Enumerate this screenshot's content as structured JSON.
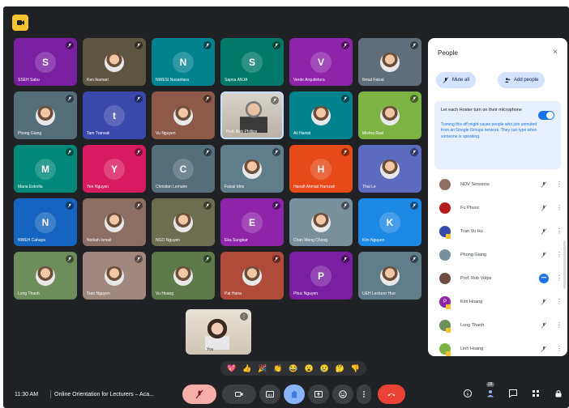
{
  "meeting": {
    "time": "11:30 AM",
    "title": "Online Orientation for Lecturers – Aca..."
  },
  "colors": {
    "background": "#202124",
    "control": "#3c4043",
    "end_call": "#ea4335",
    "accent": "#8ab4f8",
    "host_box": "#e8f0fe"
  },
  "tiles": [
    {
      "name": "SSEH Sabu",
      "letter": "S",
      "bg": "#7b1fa2",
      "type": "letter"
    },
    {
      "name": "Ken Ikamari",
      "letter": "",
      "bg": "#5d5540",
      "type": "photo"
    },
    {
      "name": "NWESI Nusantara",
      "letter": "N",
      "bg": "#00838f",
      "type": "letter"
    },
    {
      "name": "Sapna ANJA",
      "letter": "S",
      "bg": "#00796b",
      "type": "letter"
    },
    {
      "name": "Verde Arquitetura",
      "letter": "V",
      "bg": "#8e24aa",
      "type": "letter"
    },
    {
      "name": "Ikmal Faizal",
      "letter": "",
      "bg": "#5f6e78",
      "type": "photo"
    },
    {
      "name": "Phong Giang",
      "letter": "",
      "bg": "#546e7a",
      "type": "photo"
    },
    {
      "name": "Tam Tranvali",
      "letter": "t",
      "bg": "#3949ab",
      "type": "letter"
    },
    {
      "name": "Vu Nguyen",
      "letter": "",
      "bg": "#8d5a4a",
      "type": "photo"
    },
    {
      "name": "Prof. Rob Phillips",
      "letter": "",
      "bg": "#cfc8bb",
      "type": "video"
    },
    {
      "name": "Ali Hamid",
      "letter": "",
      "bg": "#00838f",
      "type": "photo"
    },
    {
      "name": "Mishra Ravi",
      "letter": "",
      "bg": "#7cb342",
      "type": "photo"
    },
    {
      "name": "Maria Estrella",
      "letter": "M",
      "bg": "#00897b",
      "type": "letter"
    },
    {
      "name": "Yen Nguyen",
      "letter": "Y",
      "bg": "#d81b60",
      "type": "letter"
    },
    {
      "name": "Christian Lemaire",
      "letter": "C",
      "bg": "#546e7a",
      "type": "letter"
    },
    {
      "name": "Faisal Idris",
      "letter": "",
      "bg": "#607d8b",
      "type": "photo"
    },
    {
      "name": "Hanafi Ahmad Hamzah",
      "letter": "H",
      "bg": "#e64a19",
      "type": "letter"
    },
    {
      "name": "Thai Le",
      "letter": "",
      "bg": "#5c6bc0",
      "type": "photo"
    },
    {
      "name": "NWEH Cahaya",
      "letter": "N",
      "bg": "#1565c0",
      "type": "letter"
    },
    {
      "name": "Norliah Ismail",
      "letter": "",
      "bg": "#8d6e63",
      "type": "photo"
    },
    {
      "name": "NGO Nguyen",
      "letter": "",
      "bg": "#6d6d4f",
      "type": "photo"
    },
    {
      "name": "Eka Sungkar",
      "letter": "E",
      "bg": "#8e24aa",
      "type": "letter"
    },
    {
      "name": "Chan Meng Chong",
      "letter": "",
      "bg": "#78909c",
      "type": "photo"
    },
    {
      "name": "Kim Nguyen",
      "letter": "K",
      "bg": "#1e88e5",
      "type": "letter"
    },
    {
      "name": "Long Thanh",
      "letter": "",
      "bg": "#6b8e5a",
      "type": "photo"
    },
    {
      "name": "Tran Nguyen",
      "letter": "",
      "bg": "#a1887f",
      "type": "photo"
    },
    {
      "name": "Vu Hoang",
      "letter": "",
      "bg": "#5d7a4a",
      "type": "photo"
    },
    {
      "name": "Pat Hana",
      "letter": "",
      "bg": "#b04a3a",
      "type": "photo"
    },
    {
      "name": "Phuc Nguyen",
      "letter": "P",
      "bg": "#7b1fa2",
      "type": "letter"
    },
    {
      "name": "UEH Lecturer Hue",
      "letter": "",
      "bg": "#607d8b",
      "type": "photo"
    }
  ],
  "self_view": {
    "name": "You"
  },
  "reactions": [
    "💖",
    "👍",
    "🎉",
    "👏",
    "😂",
    "😮",
    "😢",
    "🤔",
    "👎"
  ],
  "panel": {
    "title": "People",
    "close": "×",
    "mute_all": "Mute all",
    "add_people": "Add people",
    "host_text": "Let each Hoster turn on their microphone",
    "host_desc": "Turning this off might cause people who join unmuted from an Google Groups network. They can type when someone is speaking.",
    "people": [
      {
        "name": "NOV Sessions",
        "bg": "#8d6e63",
        "letter": "",
        "hand": false,
        "speaking": false
      },
      {
        "name": "Fu Phuoc",
        "bg": "#b71c1c",
        "letter": "",
        "hand": false,
        "speaking": false
      },
      {
        "name": "Tran Vu Hu",
        "bg": "#3949ab",
        "letter": "",
        "hand": true,
        "speaking": false
      },
      {
        "name": "Phong Giang",
        "bg": "#78909c",
        "letter": "",
        "hand": false,
        "speaking": false
      },
      {
        "name": "Prof. Rob Volpe",
        "bg": "#6d4c41",
        "letter": "",
        "hand": false,
        "speaking": true
      },
      {
        "name": "Kim Hoang",
        "bg": "#8e24aa",
        "letter": "P",
        "hand": true,
        "speaking": false
      },
      {
        "name": "Long Thanh",
        "bg": "#6b8e5a",
        "letter": "",
        "hand": true,
        "speaking": false
      },
      {
        "name": "Linh Hoang",
        "bg": "#7cb342",
        "letter": "",
        "hand": true,
        "speaking": false
      }
    ]
  },
  "participants_badge": "28"
}
